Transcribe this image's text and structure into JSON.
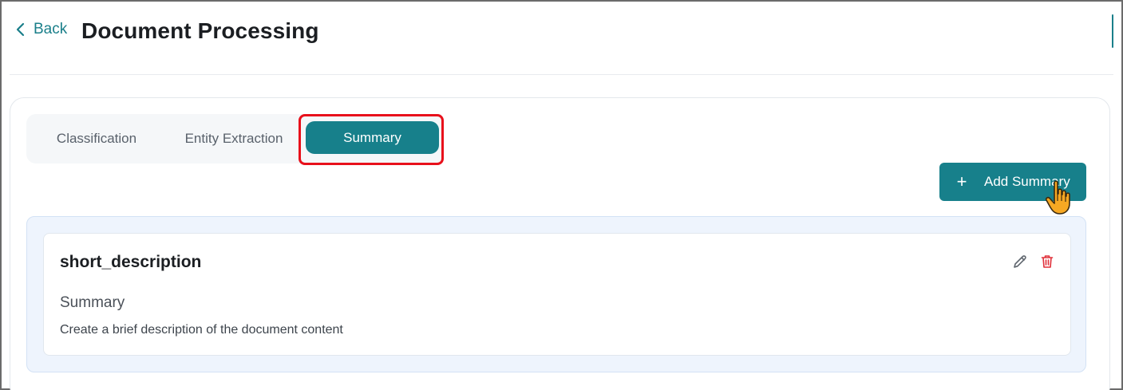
{
  "header": {
    "back_label": "Back",
    "title": "Document Processing"
  },
  "tabs": [
    {
      "label": "Classification",
      "active": false
    },
    {
      "label": "Entity Extraction",
      "active": false
    },
    {
      "label": "Summary",
      "active": true
    }
  ],
  "toolbar": {
    "add_label": "Add Summary",
    "add_icon": "plus-icon"
  },
  "summaries": [
    {
      "name": "short_description",
      "type": "Summary",
      "description": "Create a brief description of the document content",
      "actions": [
        "pencil-icon",
        "trash-icon"
      ]
    }
  ],
  "colors": {
    "accent": "#17808b",
    "highlight": "#e8101b",
    "delete": "#e0303a",
    "list_background": "#eef4fd"
  }
}
